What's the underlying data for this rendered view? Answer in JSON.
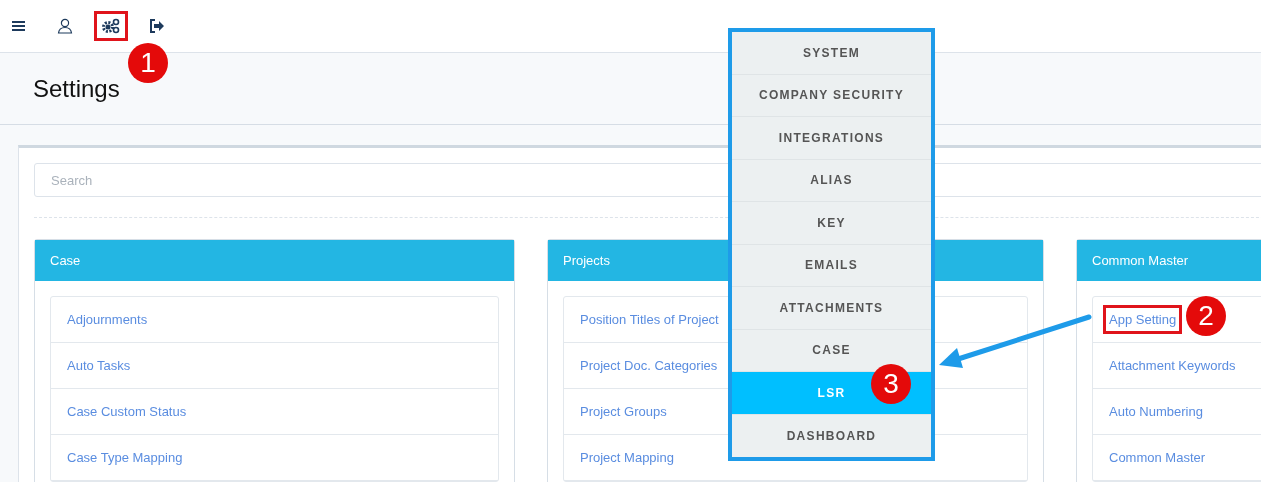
{
  "toolbar": [
    {
      "kind": "menu",
      "highlight": false
    },
    {
      "kind": "user",
      "highlight": false
    },
    {
      "kind": "settings",
      "highlight": true
    },
    {
      "kind": "logout",
      "highlight": false
    }
  ],
  "page_title": "Settings",
  "search": {
    "placeholder": "Search"
  },
  "panels": [
    {
      "title": "Case",
      "items": [
        {
          "label": "Adjournments",
          "highlight": false
        },
        {
          "label": "Auto Tasks",
          "highlight": false
        },
        {
          "label": "Case Custom Status",
          "highlight": false
        },
        {
          "label": "Case Type Mapping",
          "highlight": false
        }
      ]
    },
    {
      "title": "Projects",
      "items": [
        {
          "label": "Position Titles of Project",
          "highlight": false
        },
        {
          "label": "Project Doc. Categories",
          "highlight": false
        },
        {
          "label": "Project Groups",
          "highlight": false
        },
        {
          "label": "Project Mapping",
          "highlight": false
        }
      ]
    },
    {
      "title": "Common Master",
      "items": [
        {
          "label": "App Setting",
          "highlight": true
        },
        {
          "label": "Attachment Keywords",
          "highlight": false
        },
        {
          "label": "Auto Numbering",
          "highlight": false
        },
        {
          "label": "Common Master",
          "highlight": false
        }
      ]
    }
  ],
  "menu": [
    {
      "label": "SYSTEM",
      "selected": false
    },
    {
      "label": "COMPANY SECURITY",
      "selected": false
    },
    {
      "label": "INTEGRATIONS",
      "selected": false
    },
    {
      "label": "ALIAS",
      "selected": false
    },
    {
      "label": "KEY",
      "selected": false
    },
    {
      "label": "EMAILS",
      "selected": false
    },
    {
      "label": "ATTACHMENTS",
      "selected": false
    },
    {
      "label": "CASE",
      "selected": false
    },
    {
      "label": "LSR",
      "selected": true
    },
    {
      "label": "DASHBOARD",
      "selected": false
    }
  ],
  "callouts": [
    "1",
    "2",
    "3"
  ]
}
